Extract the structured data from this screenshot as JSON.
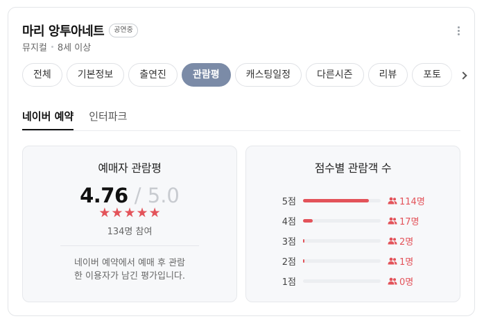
{
  "header": {
    "title": "마리 앙투아네트",
    "badge": "공연중",
    "genre": "뮤지컬",
    "age": "8세 이상"
  },
  "tabs": [
    {
      "label": "전체",
      "active": false
    },
    {
      "label": "기본정보",
      "active": false
    },
    {
      "label": "출연진",
      "active": false
    },
    {
      "label": "관람평",
      "active": true
    },
    {
      "label": "캐스팅일정",
      "active": false
    },
    {
      "label": "다른시즌",
      "active": false
    },
    {
      "label": "리뷰",
      "active": false
    },
    {
      "label": "포토",
      "active": false
    }
  ],
  "subtabs": [
    {
      "label": "네이버 예약",
      "active": true
    },
    {
      "label": "인터파크",
      "active": false
    }
  ],
  "rating_panel": {
    "title": "예매자 관람평",
    "score": "4.76",
    "max": "/ 5.0",
    "stars": 5,
    "participants": "134명 참여",
    "note_line1": "네이버 예약에서 예매 후 관람",
    "note_line2": "한 이용자가 남긴 평가입니다."
  },
  "distribution_panel": {
    "title": "점수별 관람객 수",
    "rows": [
      {
        "label": "5점",
        "count": "114명",
        "value": 114
      },
      {
        "label": "4점",
        "count": "17명",
        "value": 17
      },
      {
        "label": "3점",
        "count": "2명",
        "value": 2
      },
      {
        "label": "2점",
        "count": "1명",
        "value": 1
      },
      {
        "label": "1점",
        "count": "0명",
        "value": 0
      }
    ],
    "total": 134
  },
  "colors": {
    "accent": "#e3535a",
    "active_tab": "#7b8ba7"
  },
  "icons": {
    "more": "more-vertical-icon",
    "next": "chevron-right-icon",
    "star": "star-icon",
    "person": "people-icon"
  }
}
